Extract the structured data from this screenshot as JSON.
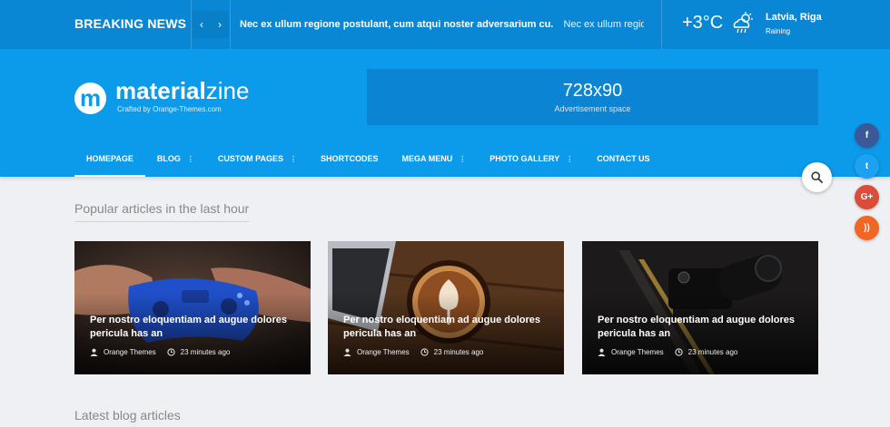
{
  "topbar": {
    "breaking_title": "BREAKING NEWS",
    "prev_icon": "chevron-left-icon",
    "next_icon": "chevron-right-icon",
    "news_active": "Nec ex ullum regione postulant, cum atqui noster adversarium cu.",
    "news_next": "Nec ex ullum regione postu...",
    "temperature": "+3°C",
    "weather_icon": "cloud-rain-sun-icon",
    "location": "Latvia, Riga",
    "condition": "Raining"
  },
  "header": {
    "logo_letter": "m",
    "logo_bold": "material",
    "logo_light": "zine",
    "tagline": "Crafted by Orange-Themes.com",
    "ad_size": "728x90",
    "ad_label": "Advertisement space"
  },
  "menu": [
    {
      "label": "HOMEPAGE",
      "dropdown": ""
    },
    {
      "label": "BLOG",
      "dropdown": "⋮"
    },
    {
      "label": "CUSTOM PAGES",
      "dropdown": "⋮"
    },
    {
      "label": "SHORTCODES",
      "dropdown": ""
    },
    {
      "label": "MEGA MENU",
      "dropdown": "⋮"
    },
    {
      "label": "PHOTO GALLERY",
      "dropdown": "⋮"
    },
    {
      "label": "CONTACT US",
      "dropdown": ""
    }
  ],
  "social": [
    {
      "icon": "facebook-icon",
      "glyph": "f",
      "color": "#3b5998"
    },
    {
      "icon": "twitter-icon",
      "glyph": "t",
      "color": "#1da1f2"
    },
    {
      "icon": "google-plus-icon",
      "glyph": "G+",
      "color": "#dd4b39"
    },
    {
      "icon": "rss-icon",
      "glyph": "))",
      "color": "#f26522"
    }
  ],
  "sections": {
    "popular": "Popular articles in the last hour",
    "latest": "Latest blog articles"
  },
  "articles": [
    {
      "title": "Per nostro eloquentiam ad augue dolores pericula has an",
      "author": "Orange Themes",
      "time": "23 minutes ago",
      "image": "gamepad-image"
    },
    {
      "title": "Per nostro eloquentiam ad augue dolores pericula has an",
      "author": "Orange Themes",
      "time": "23 minutes ago",
      "image": "coffee-laptop-image"
    },
    {
      "title": "Per nostro eloquentiam ad augue dolores pericula has an",
      "author": "Orange Themes",
      "time": "23 minutes ago",
      "image": "camera-image"
    }
  ],
  "colors": {
    "topbar": "#0a87d4",
    "header": "#0c9aeb",
    "background": "#eef0f3"
  }
}
